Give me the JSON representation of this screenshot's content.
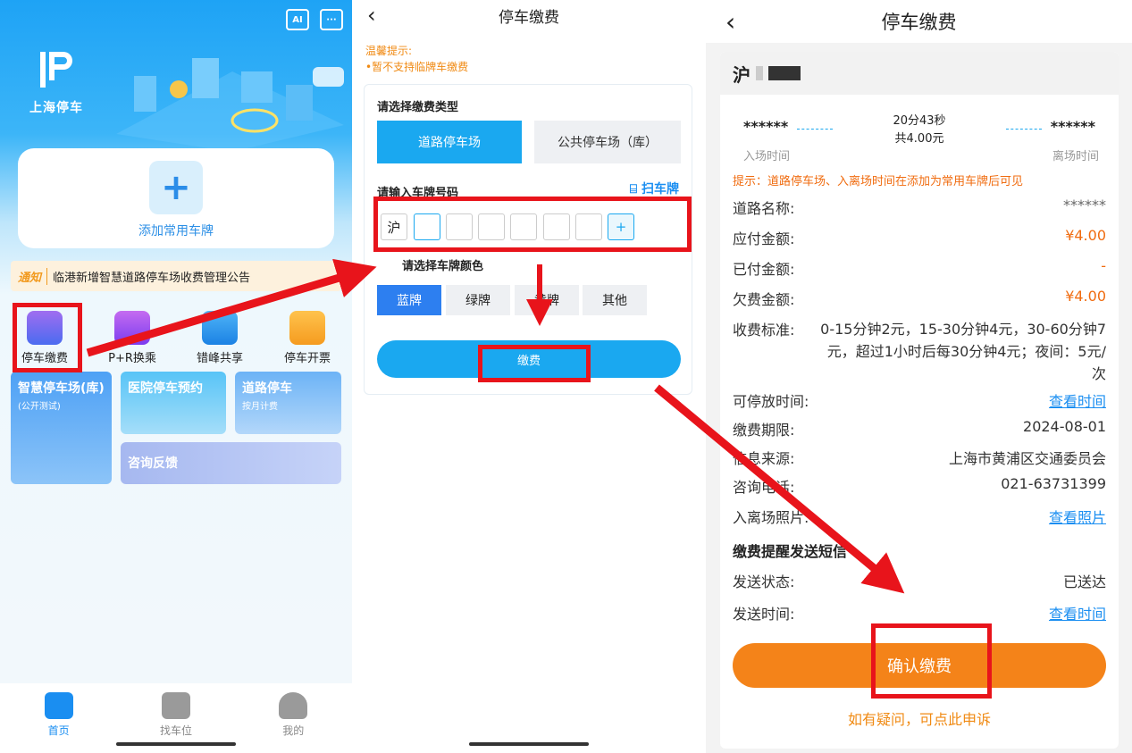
{
  "home": {
    "app_name": "上海停车",
    "add_plate_label": "添加常用车牌",
    "notice_tag": "通知",
    "notice_text": "临港新增智慧道路停车场收费管理公告",
    "quick_actions": [
      "停车缴费",
      "P+R换乘",
      "错峰共享",
      "停车开票"
    ],
    "tiles": {
      "smart_lot": {
        "title": "智慧停车场(库)",
        "sub": "(公开测试)"
      },
      "hospital": {
        "title": "医院停车预约"
      },
      "road": {
        "title": "道路停车",
        "sub": "按月计费"
      },
      "feedback": {
        "title": "咨询反馈"
      }
    },
    "bottom_nav": [
      "首页",
      "找车位",
      "我的"
    ],
    "ai_icon_label": "AI"
  },
  "payment": {
    "title": "停车缴费",
    "tip_title": "温馨提示:",
    "tip_text": "•暂不支持临牌车缴费",
    "type_label": "请选择缴费类型",
    "type_options": [
      "道路停车场",
      "公共停车场（库）"
    ],
    "plate_label": "请输入车牌号码",
    "scan_label": "扫车牌",
    "plate_prefix": "沪",
    "plus": "+",
    "color_label": "请选择车牌颜色",
    "colors": [
      "蓝牌",
      "绿牌",
      "黄牌",
      "其他"
    ],
    "pay_button": "缴费"
  },
  "detail": {
    "title": "停车缴费",
    "plate_prefix": "沪",
    "entry_time": "******",
    "exit_time": "******",
    "duration": "20分43秒",
    "total": "共4.00元",
    "entry_label": "入场时间",
    "exit_label": "离场时间",
    "hint": "提示：道路停车场、入离场时间在添加为常用车牌后可见",
    "rows": [
      {
        "label": "道路名称:",
        "value": "******"
      },
      {
        "label": "应付金额:",
        "value": "¥4.00"
      },
      {
        "label": "已付金额:",
        "value": "-"
      },
      {
        "label": "欠费金额:",
        "value": "¥4.00"
      }
    ],
    "fee_label": "收费标准:",
    "fee_text": "0-15分钟2元，15-30分钟4元，30-60分钟7元，超过1小时后每30分钟4元；夜间：5元/次",
    "rows2": [
      {
        "label": "可停放时间:",
        "value": "查看时间"
      },
      {
        "label": "缴费期限:",
        "value": "2024-08-01"
      },
      {
        "label": "信息来源:",
        "value": "上海市黄浦区交通委员会"
      },
      {
        "label": "咨询电话:",
        "value": "021-63731399"
      },
      {
        "label": "入离场照片:",
        "value": "查看照片"
      }
    ],
    "sms_title": "缴费提醒发送短信",
    "rows3": [
      {
        "label": "发送状态:",
        "value": "已送达"
      },
      {
        "label": "发送时间:",
        "value": "查看时间"
      }
    ],
    "confirm_button": "确认缴费",
    "appeal_link": "如有疑问，可点此申诉"
  },
  "colors": {
    "primary_blue": "#1aa8f0",
    "orange": "#f48319",
    "annotation_red": "#e8141b"
  }
}
